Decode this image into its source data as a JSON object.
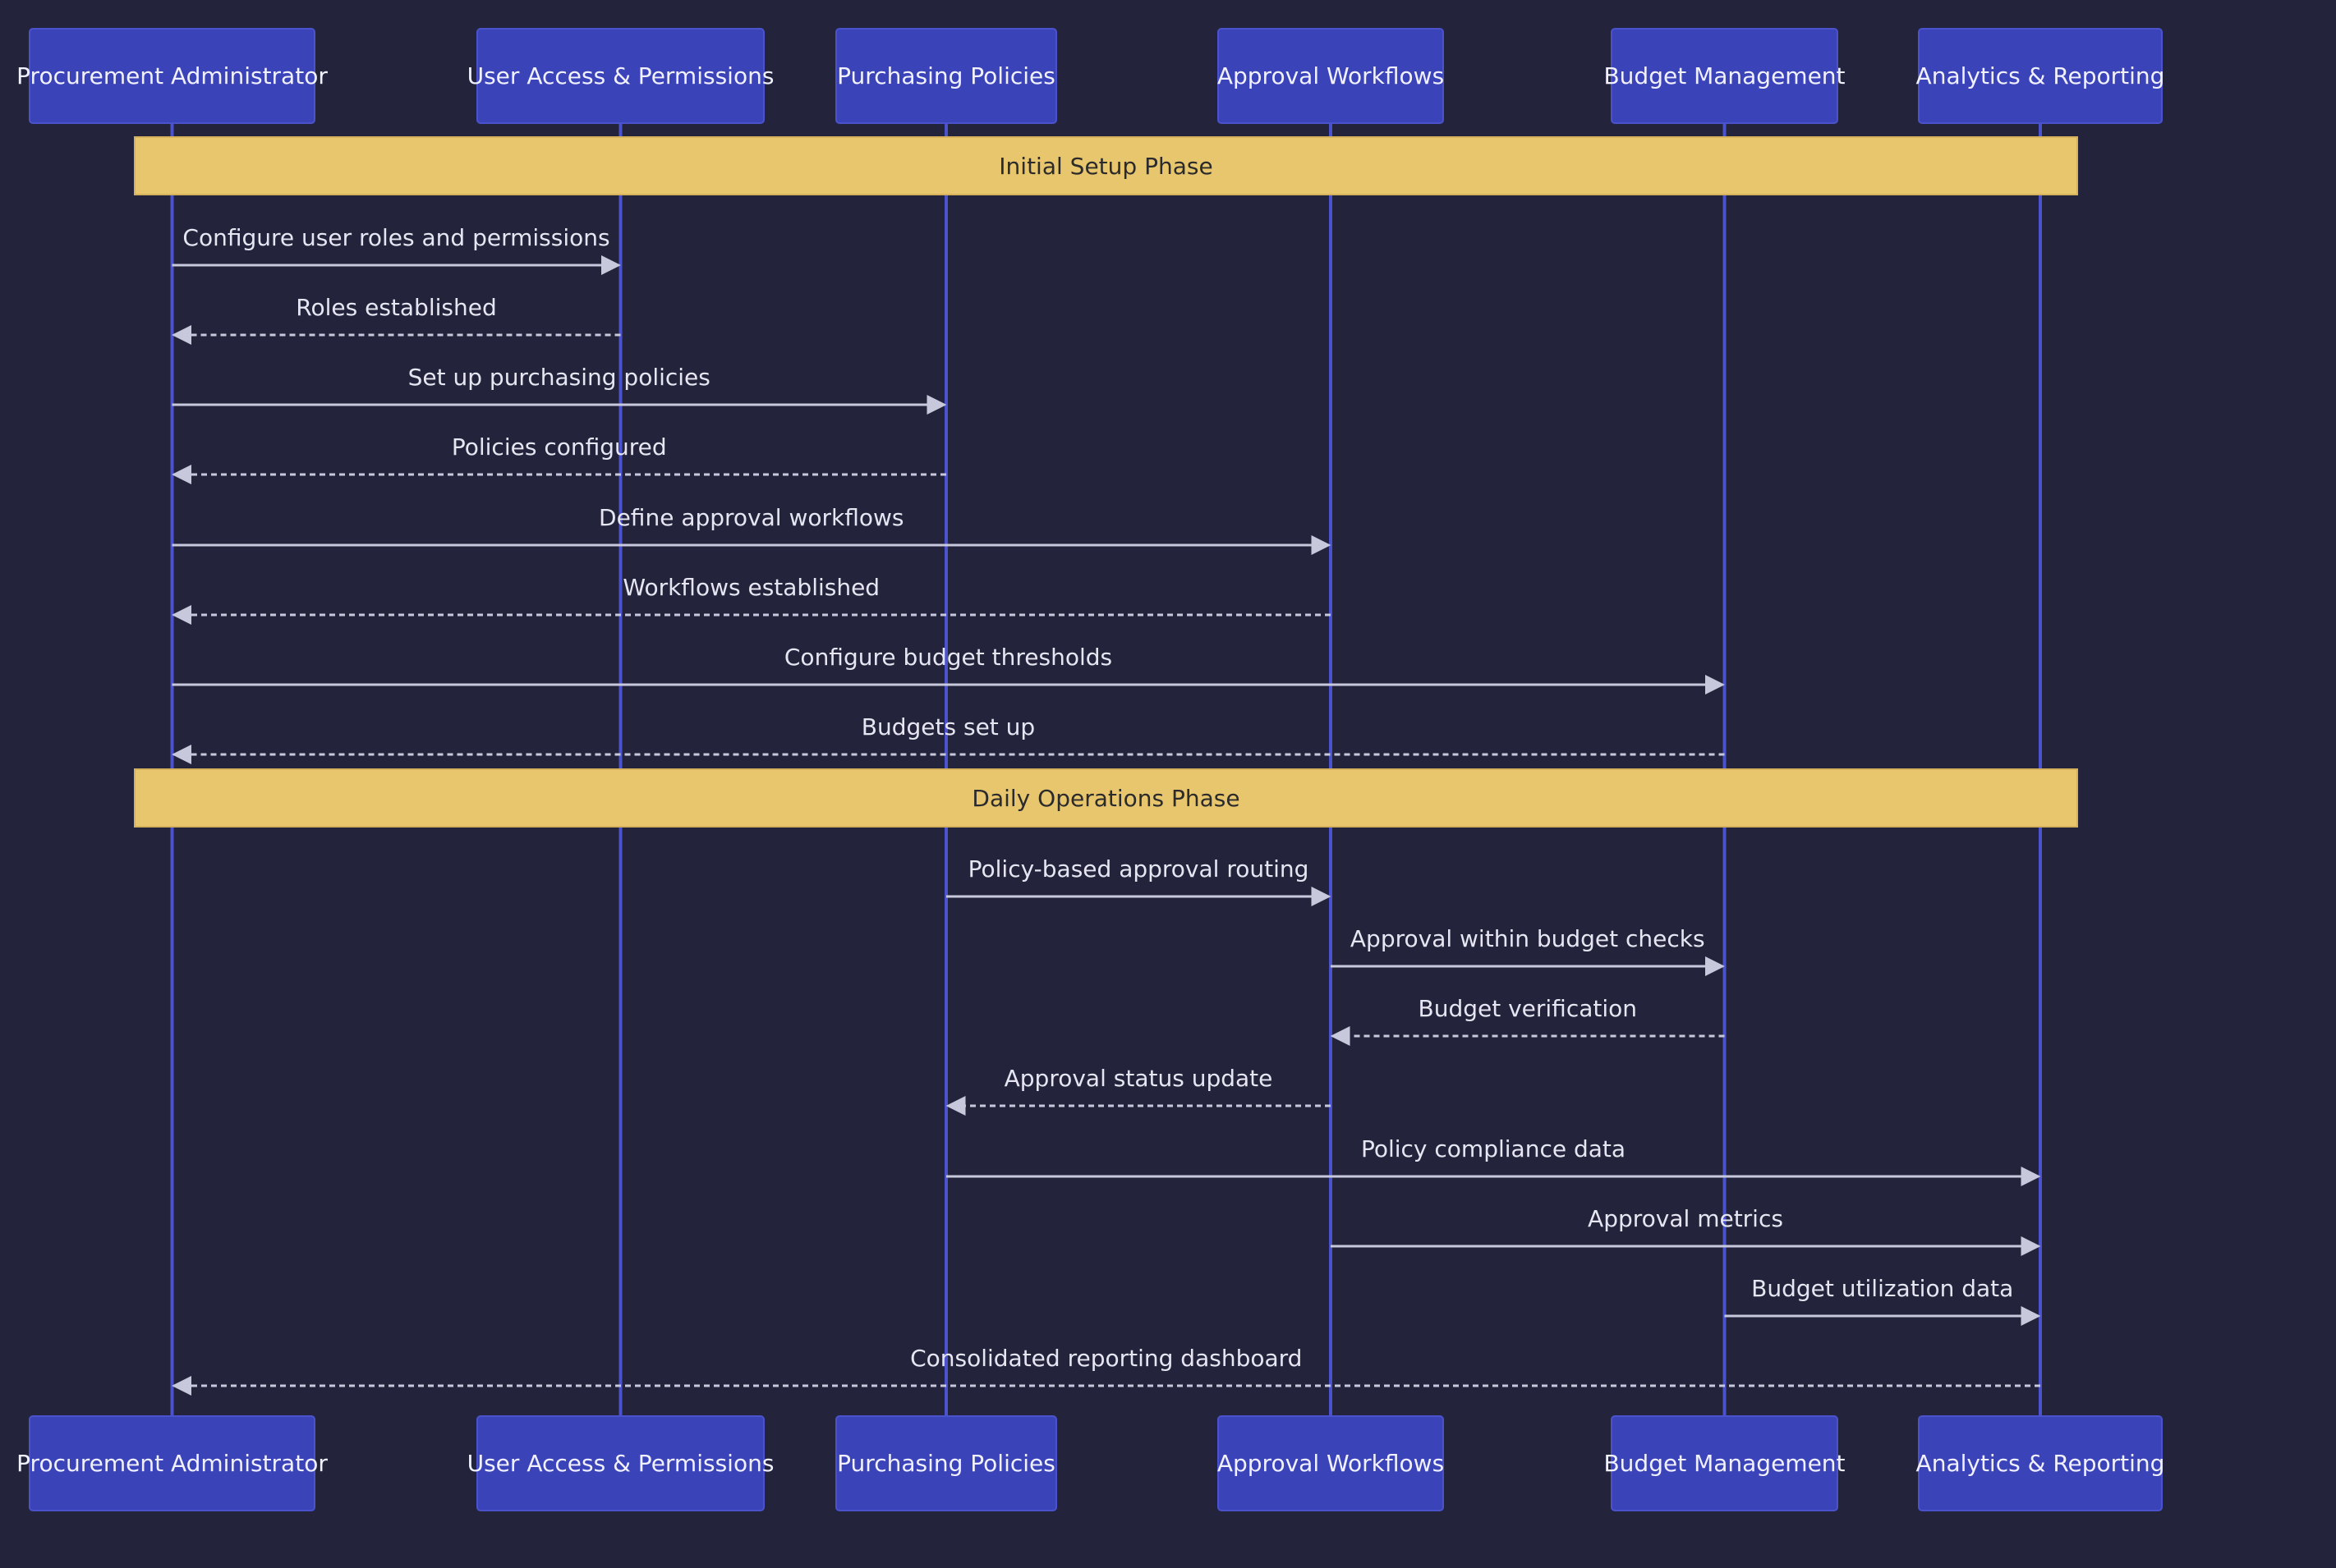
{
  "colors": {
    "background": "#23233b",
    "actor_fill": "#3b43b8",
    "lifeline": "#4a53cc",
    "note_fill": "#e8c66e",
    "arrow": "#c8c8dc",
    "text": "#e6e6f2"
  },
  "participants": [
    {
      "id": "admin",
      "label": "Procurement Administrator"
    },
    {
      "id": "access",
      "label": "User Access & Permissions"
    },
    {
      "id": "policies",
      "label": "Purchasing Policies"
    },
    {
      "id": "workflows",
      "label": "Approval Workflows"
    },
    {
      "id": "budget",
      "label": "Budget Management"
    },
    {
      "id": "analytics",
      "label": "Analytics & Reporting"
    }
  ],
  "notes": [
    {
      "text": "Initial Setup Phase",
      "from": "admin",
      "to": "analytics",
      "before_message": 0
    },
    {
      "text": "Daily Operations Phase",
      "from": "admin",
      "to": "analytics",
      "before_message": 8
    }
  ],
  "messages": [
    {
      "from": "admin",
      "to": "access",
      "text": "Configure user roles and permissions",
      "style": "solid"
    },
    {
      "from": "access",
      "to": "admin",
      "text": "Roles established",
      "style": "dashed"
    },
    {
      "from": "admin",
      "to": "policies",
      "text": "Set up purchasing policies",
      "style": "solid"
    },
    {
      "from": "policies",
      "to": "admin",
      "text": "Policies configured",
      "style": "dashed"
    },
    {
      "from": "admin",
      "to": "workflows",
      "text": "Define approval workflows",
      "style": "solid"
    },
    {
      "from": "workflows",
      "to": "admin",
      "text": "Workflows established",
      "style": "dashed"
    },
    {
      "from": "admin",
      "to": "budget",
      "text": "Configure budget thresholds",
      "style": "solid"
    },
    {
      "from": "budget",
      "to": "admin",
      "text": "Budgets set up",
      "style": "dashed"
    },
    {
      "from": "policies",
      "to": "workflows",
      "text": "Policy-based approval routing",
      "style": "solid"
    },
    {
      "from": "workflows",
      "to": "budget",
      "text": "Approval within budget checks",
      "style": "solid"
    },
    {
      "from": "budget",
      "to": "workflows",
      "text": "Budget verification",
      "style": "dashed"
    },
    {
      "from": "workflows",
      "to": "policies",
      "text": "Approval status update",
      "style": "dashed"
    },
    {
      "from": "policies",
      "to": "analytics",
      "text": "Policy compliance data",
      "style": "solid"
    },
    {
      "from": "workflows",
      "to": "analytics",
      "text": "Approval metrics",
      "style": "solid"
    },
    {
      "from": "budget",
      "to": "analytics",
      "text": "Budget utilization data",
      "style": "solid"
    },
    {
      "from": "analytics",
      "to": "admin",
      "text": "Consolidated reporting dashboard",
      "style": "dashed"
    }
  ]
}
